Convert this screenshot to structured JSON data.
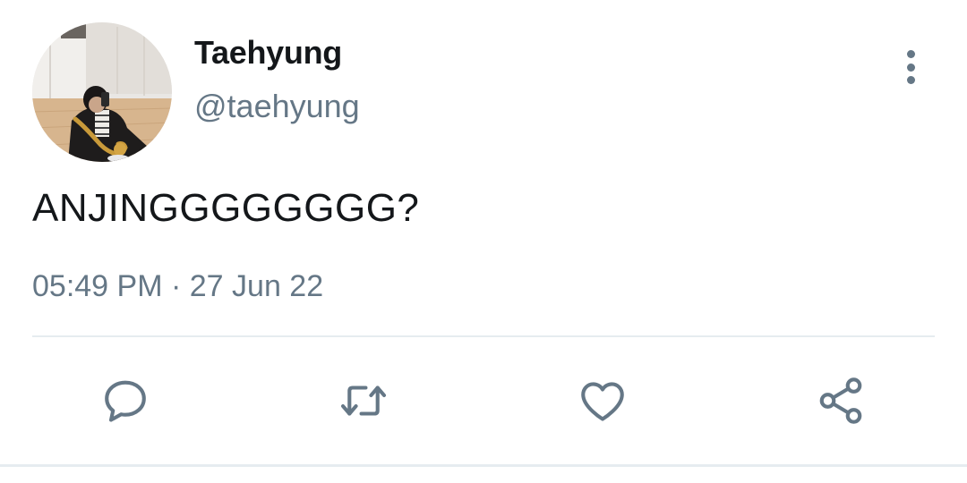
{
  "user": {
    "display_name": "Taehyung",
    "handle": "@taehyung"
  },
  "tweet": {
    "text": "ANJINGGGGGGGG?",
    "time": "05:49 PM",
    "separator": "·",
    "date": "27 Jun 22"
  },
  "actions": {
    "reply_icon": "reply-icon",
    "retweet_icon": "retweet-icon",
    "like_icon": "heart-icon",
    "share_icon": "share-icon"
  },
  "colors": {
    "text_primary": "#14171a",
    "text_secondary": "#657786",
    "divider": "#e6ecf0"
  }
}
